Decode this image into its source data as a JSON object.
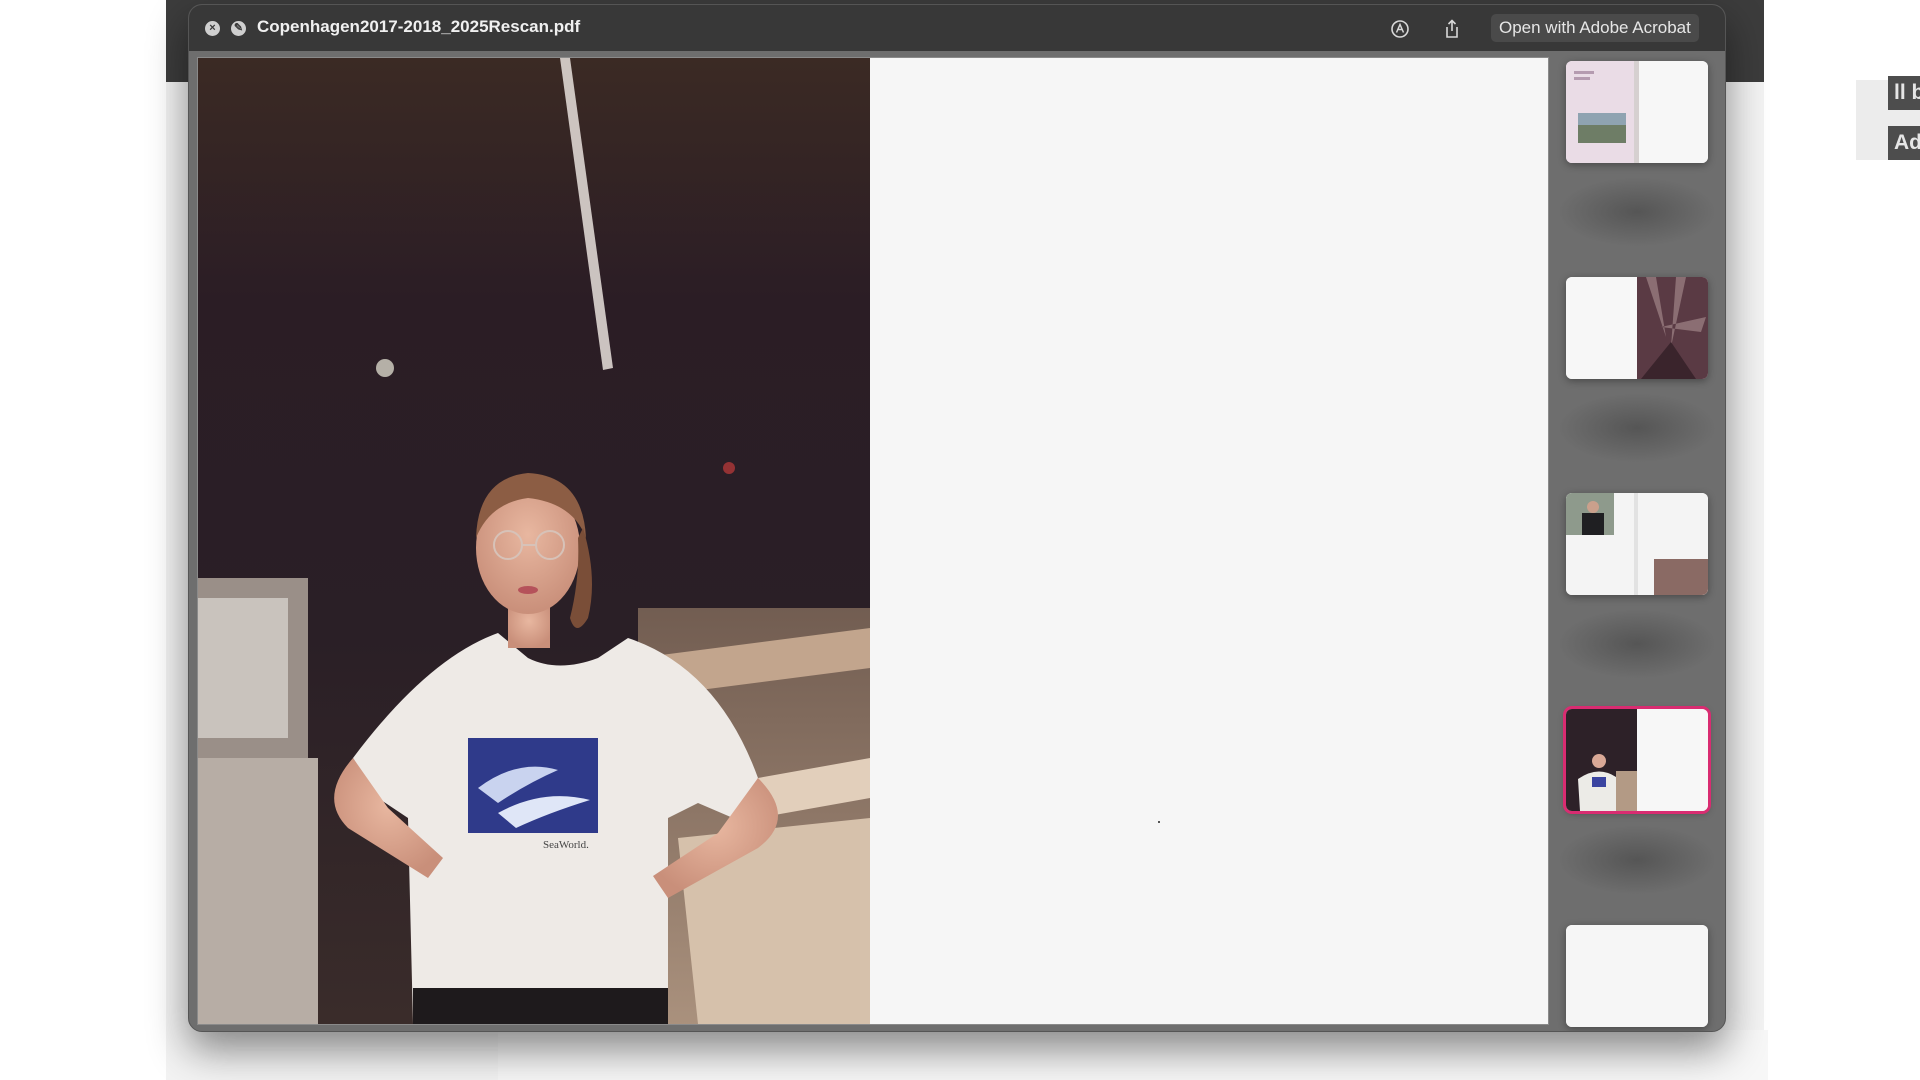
{
  "window": {
    "title": "Copenhagen2017-2018_2025Rescan.pdf",
    "open_button_label": "Open with Adobe Acrobat"
  },
  "background_app": {
    "label_1": "ll by",
    "label_2": "Add"
  },
  "icons": {
    "close": "close-icon",
    "markup": "pen-circle-icon",
    "markup_tool": "markup-tool-icon",
    "share": "share-icon"
  },
  "shirt_print": "SeaWorld.",
  "thumbnails": {
    "count": 5,
    "selected_index": 3
  },
  "colors": {
    "selection": "#d92c71",
    "titlebar": "#383838"
  }
}
